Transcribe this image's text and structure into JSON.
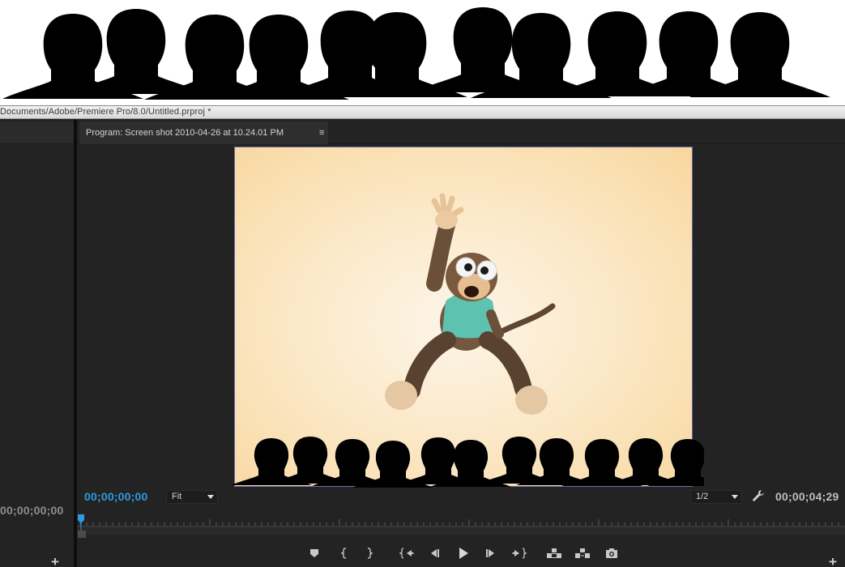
{
  "window": {
    "title": "Documents/Adobe/Premiere Pro/8.0/Untitled.prproj *"
  },
  "program_monitor": {
    "tab_label": "Program: Screen shot 2010-04-26 at 10.24.01 PM",
    "tab_menu_glyph": "≡",
    "current_timecode": "00;00;00;00",
    "duration_timecode": "00;00;04;29",
    "zoom_level": "Fit",
    "resolution": "1/2",
    "playhead_position_fraction": 0.0
  },
  "left_panel": {
    "timecode": "00;00;00;00",
    "add_glyph": "+"
  },
  "transport": {
    "buttons": [
      {
        "icon": "add-marker-icon"
      },
      {
        "icon": "mark-in-icon"
      },
      {
        "icon": "mark-out-icon"
      },
      {
        "icon": "go-to-in-icon"
      },
      {
        "icon": "step-back-icon"
      },
      {
        "icon": "play-icon"
      },
      {
        "icon": "step-forward-icon"
      },
      {
        "icon": "go-to-out-icon"
      },
      {
        "icon": "lift-icon"
      },
      {
        "icon": "extract-icon"
      },
      {
        "icon": "export-frame-icon"
      }
    ],
    "add_glyph": "+"
  },
  "colors": {
    "accent_timecode": "#2d9be0",
    "panel_bg": "#232323",
    "frame_border": "#6d6aa8"
  }
}
